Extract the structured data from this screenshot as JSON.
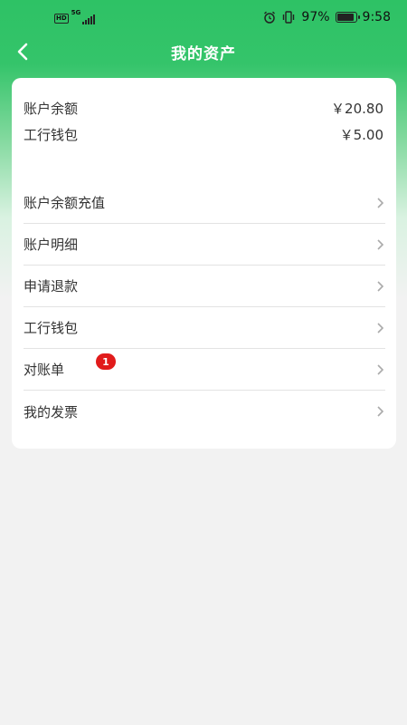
{
  "status_bar": {
    "hd": "HD",
    "network": "5G",
    "battery_percent": "97%",
    "battery_level": 0.97,
    "time": "9:58"
  },
  "header": {
    "title": "我的资产",
    "back_icon": "chevron-left-icon"
  },
  "balances": [
    {
      "label": "账户余额",
      "value": "￥20.80"
    },
    {
      "label": "工行钱包",
      "value": "￥5.00"
    }
  ],
  "menu": [
    {
      "label": "账户余额充值"
    },
    {
      "label": "账户明细"
    },
    {
      "label": "申请退款"
    },
    {
      "label": "工行钱包"
    },
    {
      "label": "对账单",
      "badge": "1"
    },
    {
      "label": "我的发票"
    }
  ],
  "colors": {
    "header_green": "#2ec265",
    "badge_red": "#e11b1b",
    "page_bg": "#f2f2f2"
  }
}
